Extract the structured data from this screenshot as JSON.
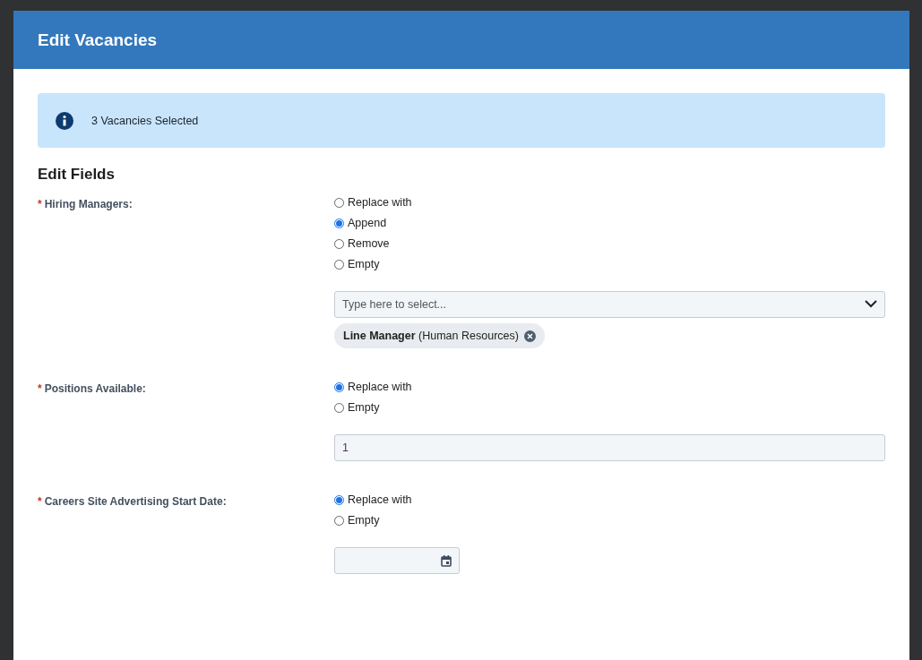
{
  "dialog": {
    "title": "Edit Vacancies"
  },
  "notice": {
    "text": "3 Vacancies Selected"
  },
  "section_title": "Edit Fields",
  "fields": [
    {
      "label": "Hiring Managers:",
      "marker": "*",
      "kind": "select",
      "options": [
        {
          "label": "Replace with",
          "selected": false
        },
        {
          "label": "Append",
          "selected": true
        },
        {
          "label": "Remove",
          "selected": false
        },
        {
          "label": "Empty",
          "selected": false
        }
      ],
      "placeholder": "Type here to select...",
      "tags": [
        {
          "name": "Line Manager",
          "detail": "(Human Resources)"
        }
      ]
    },
    {
      "label": "Positions Available:",
      "marker": "*",
      "kind": "text",
      "options": [
        {
          "label": "Replace with",
          "selected": true
        },
        {
          "label": "Empty",
          "selected": false
        }
      ],
      "value": "1"
    },
    {
      "label": "Careers Site Advertising Start Date:",
      "marker": "*",
      "kind": "date",
      "options": [
        {
          "label": "Replace with",
          "selected": true
        },
        {
          "label": "Empty",
          "selected": false
        }
      ]
    }
  ]
}
